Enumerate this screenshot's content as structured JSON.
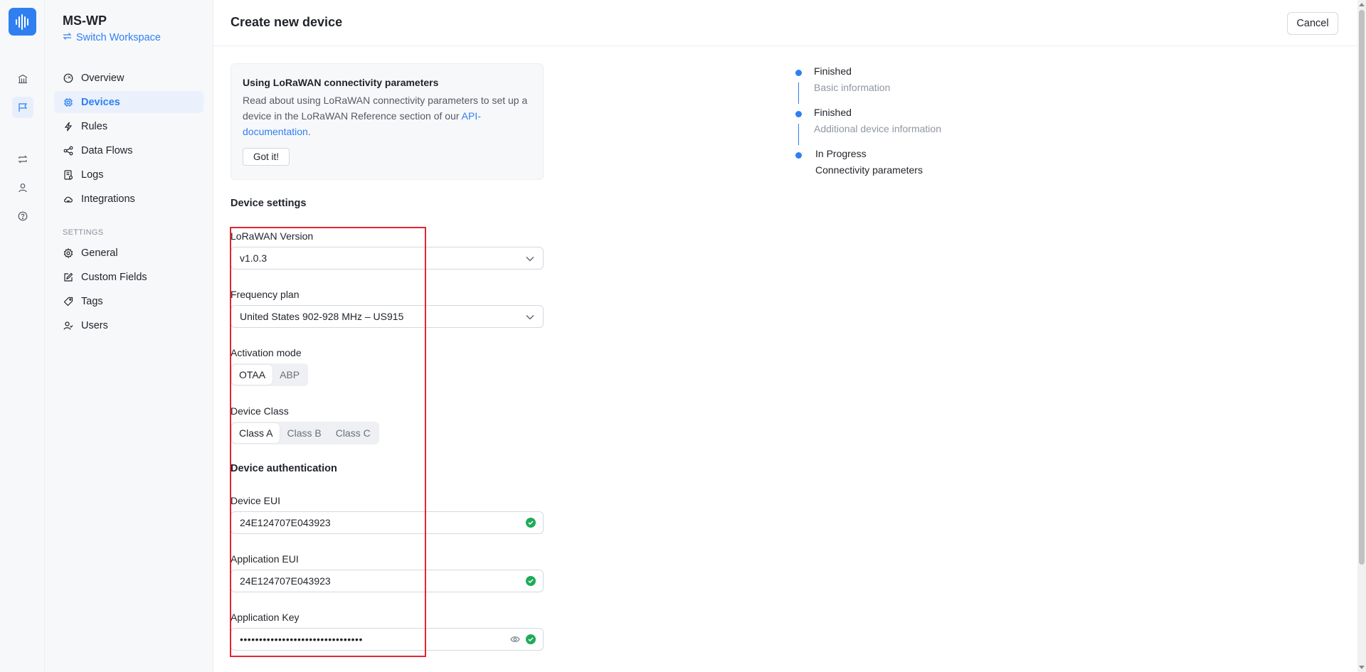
{
  "workspace": {
    "name": "MS-WP",
    "switch_label": "Switch Workspace"
  },
  "nav": {
    "items": [
      {
        "label": "Overview",
        "icon": "gauge-icon"
      },
      {
        "label": "Devices",
        "icon": "chip-icon",
        "active": true
      },
      {
        "label": "Rules",
        "icon": "bolt-icon"
      },
      {
        "label": "Data Flows",
        "icon": "share-icon"
      },
      {
        "label": "Logs",
        "icon": "log-icon"
      },
      {
        "label": "Integrations",
        "icon": "cloud-icon"
      }
    ],
    "settings_label": "SETTINGS",
    "settings_items": [
      {
        "label": "General",
        "icon": "gear-icon"
      },
      {
        "label": "Custom Fields",
        "icon": "edit-icon"
      },
      {
        "label": "Tags",
        "icon": "tag-icon"
      },
      {
        "label": "Users",
        "icon": "users-icon"
      }
    ]
  },
  "header": {
    "title": "Create new device",
    "cancel_label": "Cancel"
  },
  "info": {
    "title": "Using LoRaWAN connectivity parameters",
    "text": "Read about using LoRaWAN connectivity parameters to set up a device in the LoRaWAN Reference section of our ",
    "link": "API-documentation",
    "after_link": ".",
    "button": "Got it!"
  },
  "form": {
    "device_settings_heading": "Device settings",
    "lorawan_version_label": "LoRaWAN Version",
    "lorawan_version_value": "v1.0.3",
    "frequency_plan_label": "Frequency plan",
    "frequency_plan_value": "United States 902-928 MHz – US915",
    "activation_mode_label": "Activation mode",
    "activation_modes": [
      "OTAA",
      "ABP"
    ],
    "activation_mode_selected": "OTAA",
    "device_class_label": "Device Class",
    "device_classes": [
      "Class A",
      "Class B",
      "Class C"
    ],
    "device_class_selected": "Class A",
    "auth_heading": "Device authentication",
    "device_eui_label": "Device EUI",
    "device_eui_value": "24E124707E043923",
    "app_eui_label": "Application EUI",
    "app_eui_value": "24E124707E043923",
    "app_key_label": "Application Key",
    "app_key_value": "••••••••••••••••••••••••••••••••"
  },
  "steps": [
    {
      "status": "Finished",
      "desc": "Basic information"
    },
    {
      "status": "Finished",
      "desc": "Additional device information"
    },
    {
      "status": "In Progress",
      "desc": "Connectivity parameters"
    }
  ],
  "colors": {
    "accent": "#2f7ff1",
    "success": "#1fab59",
    "highlight": "#e4252f"
  }
}
